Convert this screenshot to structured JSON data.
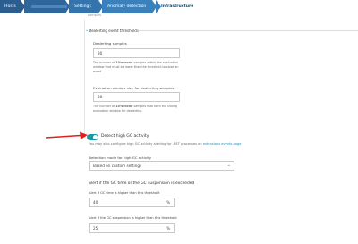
{
  "breadcrumb": {
    "hosts": "Hosts",
    "settings": "Settings",
    "anomaly": "Anomaly detection",
    "infra": "Infrastructure"
  },
  "cut_text": "samples",
  "dealerting": {
    "section_title": "Dealerting event thresholds",
    "samples_label": "Dealerting samples",
    "samples_value": "30",
    "samples_help_pre": "The number of ",
    "samples_help_em": "10-second",
    "samples_help_post": " samples within the evaluation window that must be lower than the threshold to close an event",
    "window_label": "Evaluation window size for dealerting samples",
    "window_value": "30",
    "window_help_pre": "The number of ",
    "window_help_em": "10-second",
    "window_help_post": " samples that form the sliding evaluation window for dealerting."
  },
  "gc": {
    "toggle_label": "Detect high GC activity",
    "toggle_on": true,
    "hint_pre": "You may also configure high GC activity alerting for .NET processes on ",
    "hint_link": "extensions events page",
    "mode_label": "Detection mode for high GC activity",
    "mode_value": "Based on custom settings",
    "rule_label": "Alert if the GC time or the GC suspension is exceeded",
    "time_label": "Alert if GC time is higher than this threshold",
    "time_value": "40",
    "suspension_label": "Alert if the GC suspension is higher than this threshold",
    "suspension_value": "25",
    "unit": "%"
  },
  "colors": {
    "toggle": "#1a99a7",
    "link": "#1a8fc6",
    "arrow": "#e02020",
    "breadcrumb": "#2c6fa8"
  }
}
